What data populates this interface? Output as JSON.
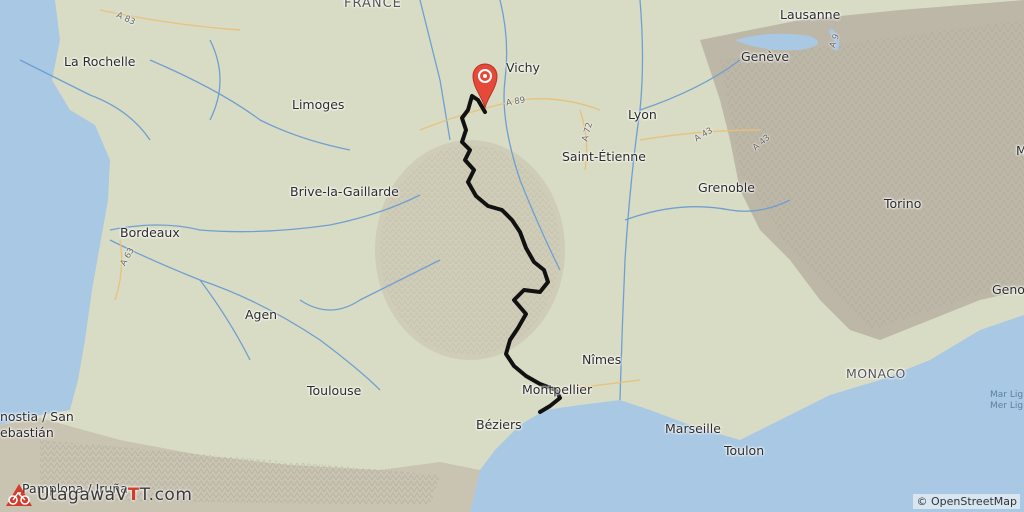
{
  "map": {
    "country_label": "FRANCE",
    "cities": [
      {
        "key": "la-rochelle",
        "label": "La Rochelle"
      },
      {
        "key": "limoges",
        "label": "Limoges"
      },
      {
        "key": "vichy",
        "label": "Vichy"
      },
      {
        "key": "lausanne",
        "label": "Lausanne"
      },
      {
        "key": "geneve",
        "label": "Genève"
      },
      {
        "key": "lyon",
        "label": "Lyon"
      },
      {
        "key": "saint-etienne",
        "label": "Saint-Étienne"
      },
      {
        "key": "brive",
        "label": "Brive-la-Gaillarde"
      },
      {
        "key": "grenoble",
        "label": "Grenoble"
      },
      {
        "key": "bordeaux",
        "label": "Bordeaux"
      },
      {
        "key": "torino",
        "label": "Torino"
      },
      {
        "key": "agen",
        "label": "Agen"
      },
      {
        "key": "nimes",
        "label": "Nîmes"
      },
      {
        "key": "monaco",
        "label": "MONACO"
      },
      {
        "key": "toulouse",
        "label": "Toulouse"
      },
      {
        "key": "montpellier",
        "label": "Montpellier"
      },
      {
        "key": "beziers",
        "label": "Béziers"
      },
      {
        "key": "marseille",
        "label": "Marseille"
      },
      {
        "key": "toulon",
        "label": "Toulon"
      },
      {
        "key": "genova",
        "label": "Geno"
      },
      {
        "key": "donostia",
        "label": "nostia / San"
      },
      {
        "key": "sebastian",
        "label": "ebastián"
      },
      {
        "key": "pamplona",
        "label": "Pamplona / Iruña"
      },
      {
        "key": "cut-m",
        "label": "M"
      }
    ],
    "sea_label": "Mar Lig\nMer Lig",
    "roads": [
      {
        "key": "a83",
        "label": "A 83"
      },
      {
        "key": "a89",
        "label": "A 89"
      },
      {
        "key": "a72",
        "label": "A 72"
      },
      {
        "key": "a43",
        "label": "A 43"
      },
      {
        "key": "a43b",
        "label": "A 43"
      },
      {
        "key": "a9",
        "label": "A 9"
      },
      {
        "key": "a63",
        "label": "A 63"
      }
    ]
  },
  "track": {
    "color": "#111111"
  },
  "marker": {
    "icon": "map-pin-icon",
    "color": "#e5493a"
  },
  "brand": {
    "prefix": "UtagawaV",
    "highlight": "T",
    "suffix": "T.com",
    "icon": "bike-icon"
  },
  "attribution": {
    "symbol": "©",
    "text": "OpenStreetMap"
  },
  "colors": {
    "sea": "#a9c8e3",
    "land": "#d9dcc4",
    "mountain": "#bdb7a8",
    "river": "#6f9fd0",
    "track": "#111111"
  }
}
